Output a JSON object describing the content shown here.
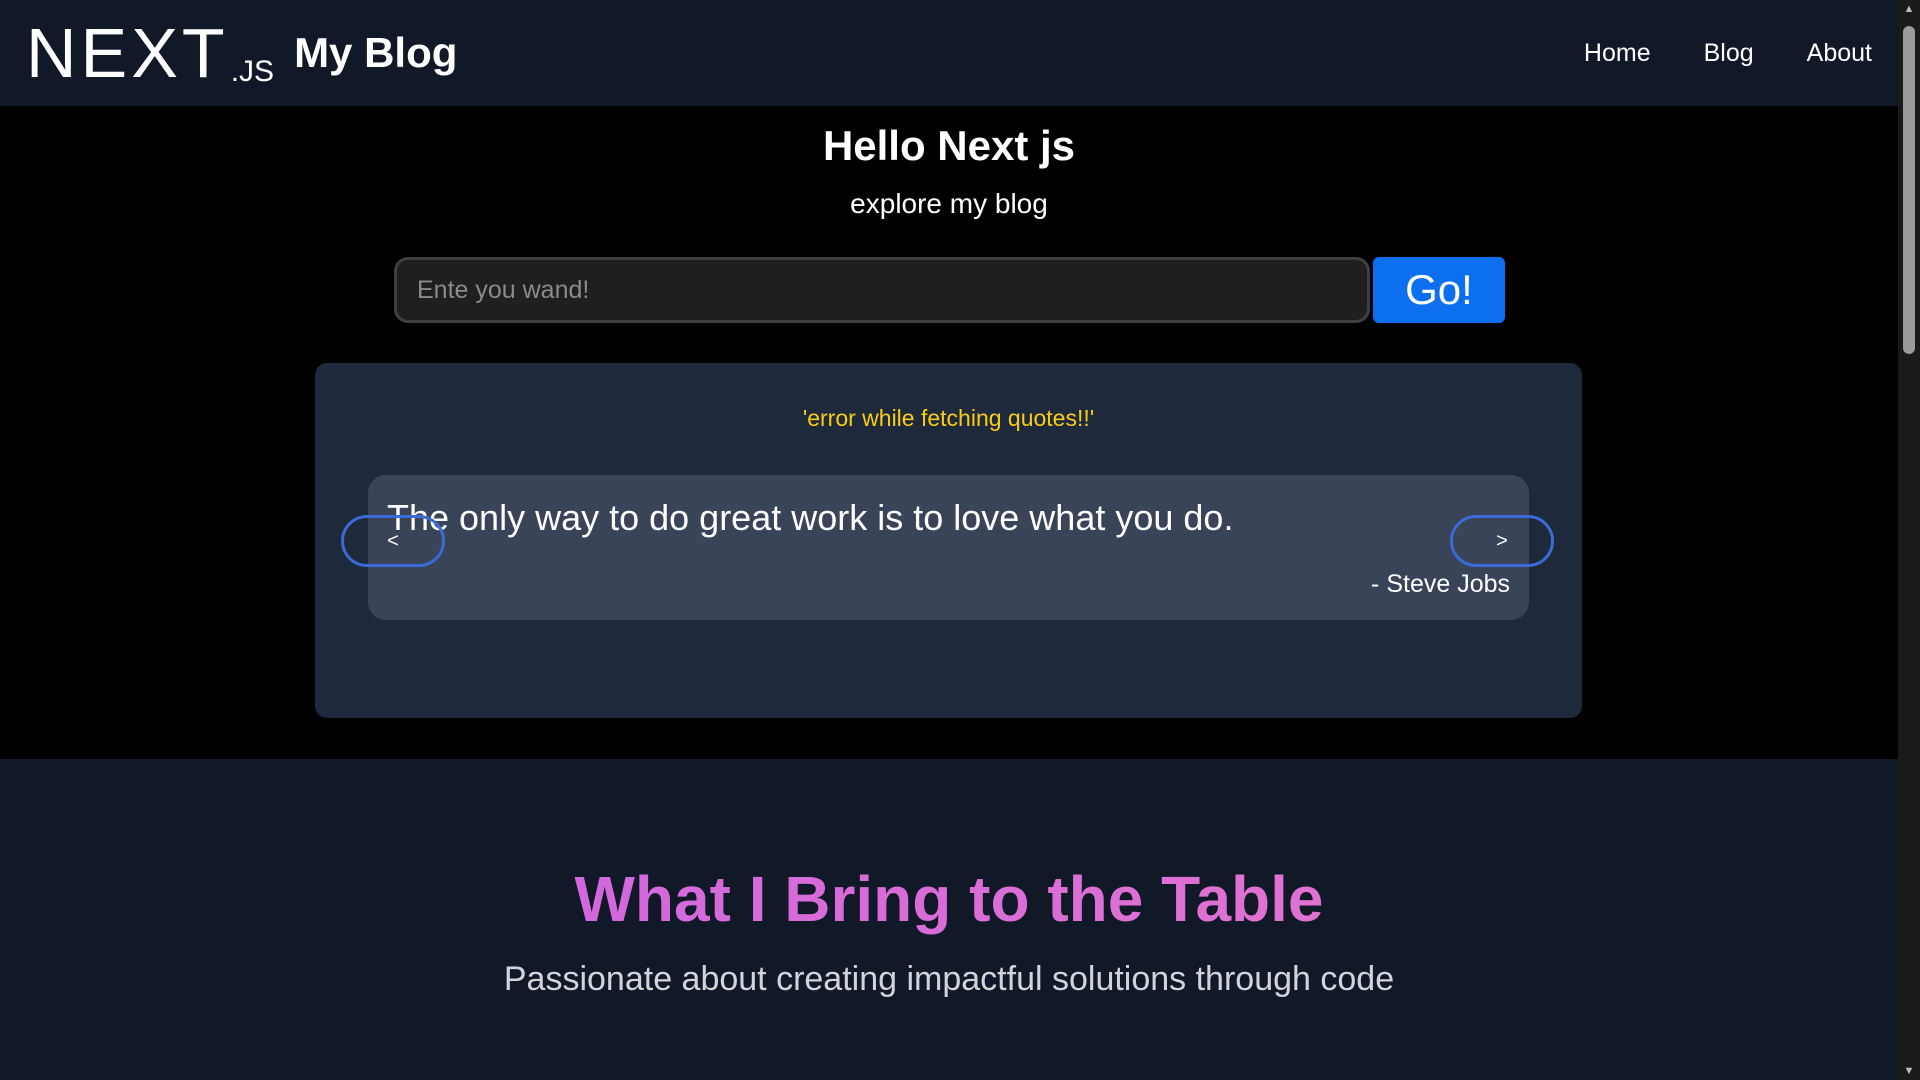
{
  "header": {
    "logo": {
      "word": "NEXT",
      "suffix": ".JS"
    },
    "site_title": "My Blog",
    "nav": [
      {
        "label": "Home"
      },
      {
        "label": "Blog"
      },
      {
        "label": "About"
      }
    ]
  },
  "hero": {
    "title": "Hello Next js",
    "subtitle": "explore my blog",
    "search": {
      "placeholder": "Ente you wand!",
      "value": ""
    },
    "go_label": "Go!"
  },
  "quotes": {
    "error_message": "'error while fetching quotes!!'",
    "current": {
      "text": "The only way to do great work is to love what you do.",
      "author": "- Steve Jobs"
    },
    "prev_label": "<",
    "next_label": ">"
  },
  "skills": {
    "title": "What I Bring to the Table",
    "subtitle": "Passionate about creating impactful solutions through code"
  },
  "scrollbar": {
    "up_icon": "▲",
    "down_icon": "▼"
  },
  "colors": {
    "header_bg": "#111827",
    "go_button": "#0b6ff0",
    "error_text": "#facc15",
    "panel_bg": "#1e293b",
    "card_bg": "#3a4459",
    "title_gradient_start": "#c860e6",
    "title_gradient_end": "#e97ac8"
  }
}
